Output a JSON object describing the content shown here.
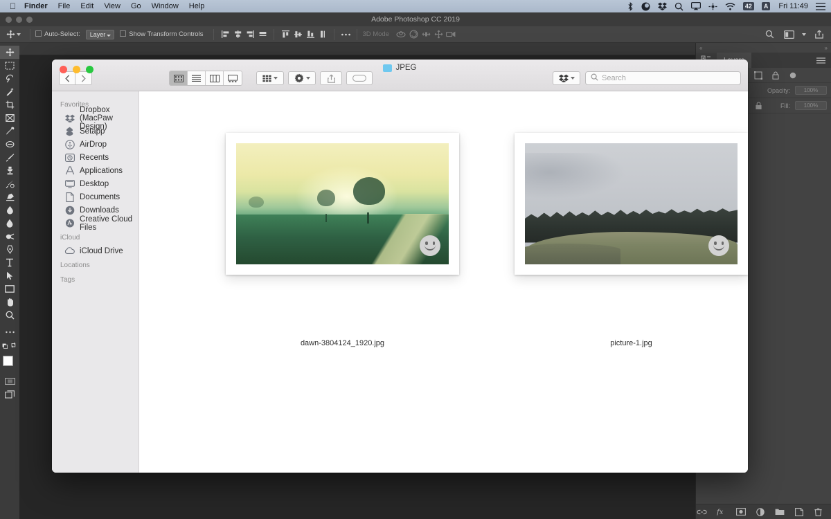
{
  "menubar": {
    "apple_icon": "apple-logo-icon",
    "items": [
      {
        "label": "Finder",
        "bold": true
      },
      {
        "label": "File",
        "bold": false
      },
      {
        "label": "Edit",
        "bold": false
      },
      {
        "label": "View",
        "bold": false
      },
      {
        "label": "Go",
        "bold": false
      },
      {
        "label": "Window",
        "bold": false
      },
      {
        "label": "Help",
        "bold": false
      }
    ],
    "status_icons": [
      "bluetooth-icon",
      "cleanmymac-icon",
      "dropbox-icon",
      "spotlight-search-icon",
      "airplay-icon",
      "bettertouchtool-icon",
      "wifi-icon",
      "battery-icon",
      "input-source-icon"
    ],
    "battery_label": "42",
    "input_source_label": "A",
    "clock": "Fri 11:49",
    "notification_icon": "notification-center-icon"
  },
  "photoshop": {
    "title": "Adobe Photoshop CC 2019",
    "options_bar": {
      "move_tool_icon": "move-tool-icon",
      "auto_select_label": "Auto-Select:",
      "layer_dropdown_value": "Layer",
      "show_transform_label": "Show Transform Controls",
      "align_icons": [
        "align-left-edges-icon",
        "align-horizontal-centers-icon",
        "align-right-edges-icon",
        "distribute-horizontally-icon"
      ],
      "align_icons_2": [
        "align-top-edges-icon",
        "align-vertical-centers-icon",
        "align-bottom-edges-icon",
        "distribute-vertically-icon"
      ],
      "more_icon": "more-options-icon",
      "mode_3d_label": "3D Mode",
      "mode_3d_icons": [
        "rotate-3d-icon",
        "roll-3d-icon",
        "drag-3d-icon",
        "slide-3d-icon",
        "scale-3d-icon"
      ],
      "right_icons": [
        "search-icon",
        "workspace-icon",
        "share-icon"
      ]
    },
    "tools": [
      {
        "name": "move-tool-icon",
        "active": true
      },
      {
        "name": "rectangular-marquee-tool-icon",
        "active": false
      },
      {
        "name": "lasso-tool-icon",
        "active": false
      },
      {
        "name": "magic-wand-tool-icon",
        "active": false
      },
      {
        "name": "crop-tool-icon",
        "active": false
      },
      {
        "name": "frame-tool-icon",
        "active": false
      },
      {
        "name": "eyedropper-tool-icon",
        "active": false
      },
      {
        "name": "spot-healing-brush-tool-icon",
        "active": false
      },
      {
        "name": "brush-tool-icon",
        "active": false
      },
      {
        "name": "clone-stamp-tool-icon",
        "active": false
      },
      {
        "name": "history-brush-tool-icon",
        "active": false
      },
      {
        "name": "eraser-tool-icon",
        "active": false
      },
      {
        "name": "gradient-tool-icon",
        "active": false
      },
      {
        "name": "blur-tool-icon",
        "active": false
      },
      {
        "name": "dodge-tool-icon",
        "active": false
      },
      {
        "name": "pen-tool-icon",
        "active": false
      },
      {
        "name": "type-tool-icon",
        "active": false
      },
      {
        "name": "path-selection-tool-icon",
        "active": false
      },
      {
        "name": "rectangle-tool-icon",
        "active": false
      },
      {
        "name": "hand-tool-icon",
        "active": false
      },
      {
        "name": "zoom-tool-icon",
        "active": false
      },
      {
        "name": "edit-toolbar-icon",
        "active": false
      }
    ],
    "color_swatches": {
      "foreground": "#ffffff",
      "background": "#1b1bcd",
      "default_colors_icon": "default-colors-icon",
      "swap_colors_icon": "swap-colors-icon"
    },
    "mode_icons": [
      "standard-mask-mode-icon",
      "screen-mode-icon"
    ],
    "panels": {
      "tabs": [
        {
          "label": "",
          "icon": "adjustments-panel-icon",
          "active": false
        },
        {
          "label": "Layers",
          "icon": "layers-panel-icon",
          "active": true
        }
      ],
      "hamburger_icon": "panel-menu-icon",
      "filter_icons": [
        "filter-pixel-icon",
        "filter-adjustment-icon",
        "filter-type-icon",
        "filter-shape-icon",
        "filter-smart-object-icon",
        "filter-toggle-icon"
      ],
      "opacity_label": "Opacity:",
      "opacity_value": "100%",
      "fill_label": "Fill:",
      "fill_value": "100%",
      "lock_icons": [
        "lock-transparent-pixels-icon",
        "lock-image-pixels-icon",
        "lock-position-icon",
        "lock-all-icon"
      ],
      "footer_icons": [
        "link-layers-icon",
        "layer-style-fx-icon",
        "add-layer-mask-icon",
        "new-adjustment-layer-icon",
        "new-group-icon",
        "new-layer-icon",
        "delete-layer-icon"
      ]
    }
  },
  "finder": {
    "window_title": "JPEG",
    "folder_icon": "blue-folder-icon",
    "traffic_lights": {
      "close": "#ff5f57",
      "minimize": "#febc2e",
      "maximize": "#28c840"
    },
    "nav": {
      "back_icon": "chevron-left-icon",
      "forward_icon": "chevron-right-icon"
    },
    "view_buttons": [
      {
        "name": "icon-view-button",
        "icon": "icon-view-icon",
        "active": true
      },
      {
        "name": "list-view-button",
        "icon": "list-view-icon",
        "active": false
      },
      {
        "name": "column-view-button",
        "icon": "column-view-icon",
        "active": false
      },
      {
        "name": "gallery-view-button",
        "icon": "gallery-view-icon",
        "active": false
      }
    ],
    "toolbar_buttons": [
      {
        "name": "arrange-by-button",
        "icon": "arrange-grid-icon",
        "has_caret": true
      },
      {
        "name": "action-menu-button",
        "icon": "gear-icon",
        "has_caret": true
      },
      {
        "name": "share-button",
        "icon": "share-icon",
        "has_caret": false
      },
      {
        "name": "tags-button",
        "icon": "tag-icon",
        "has_caret": false
      }
    ],
    "dropbox_button": {
      "icon": "dropbox-icon",
      "has_caret": true
    },
    "search": {
      "icon": "search-icon",
      "placeholder": "Search",
      "value": ""
    },
    "sidebar": [
      {
        "header": "Favorites",
        "items": [
          {
            "label": "Dropbox (MacPaw Design)",
            "icon": "dropbox-icon"
          },
          {
            "label": "Setapp",
            "icon": "setapp-icon"
          },
          {
            "label": "AirDrop",
            "icon": "airdrop-icon"
          },
          {
            "label": "Recents",
            "icon": "recents-clock-icon"
          },
          {
            "label": "Applications",
            "icon": "applications-icon"
          },
          {
            "label": "Desktop",
            "icon": "desktop-icon"
          },
          {
            "label": "Documents",
            "icon": "documents-icon"
          },
          {
            "label": "Downloads",
            "icon": "downloads-icon"
          },
          {
            "label": "Creative Cloud Files",
            "icon": "creative-cloud-icon"
          }
        ]
      },
      {
        "header": "iCloud",
        "items": [
          {
            "label": "iCloud Drive",
            "icon": "icloud-icon"
          }
        ]
      },
      {
        "header": "Locations",
        "items": []
      },
      {
        "header": "Tags",
        "items": []
      }
    ],
    "files": [
      {
        "filename": "dawn-3804124_1920.jpg",
        "badge": "smiley-face-badge-icon"
      },
      {
        "filename": "picture-1.jpg",
        "badge": "smiley-face-badge-icon"
      }
    ]
  }
}
